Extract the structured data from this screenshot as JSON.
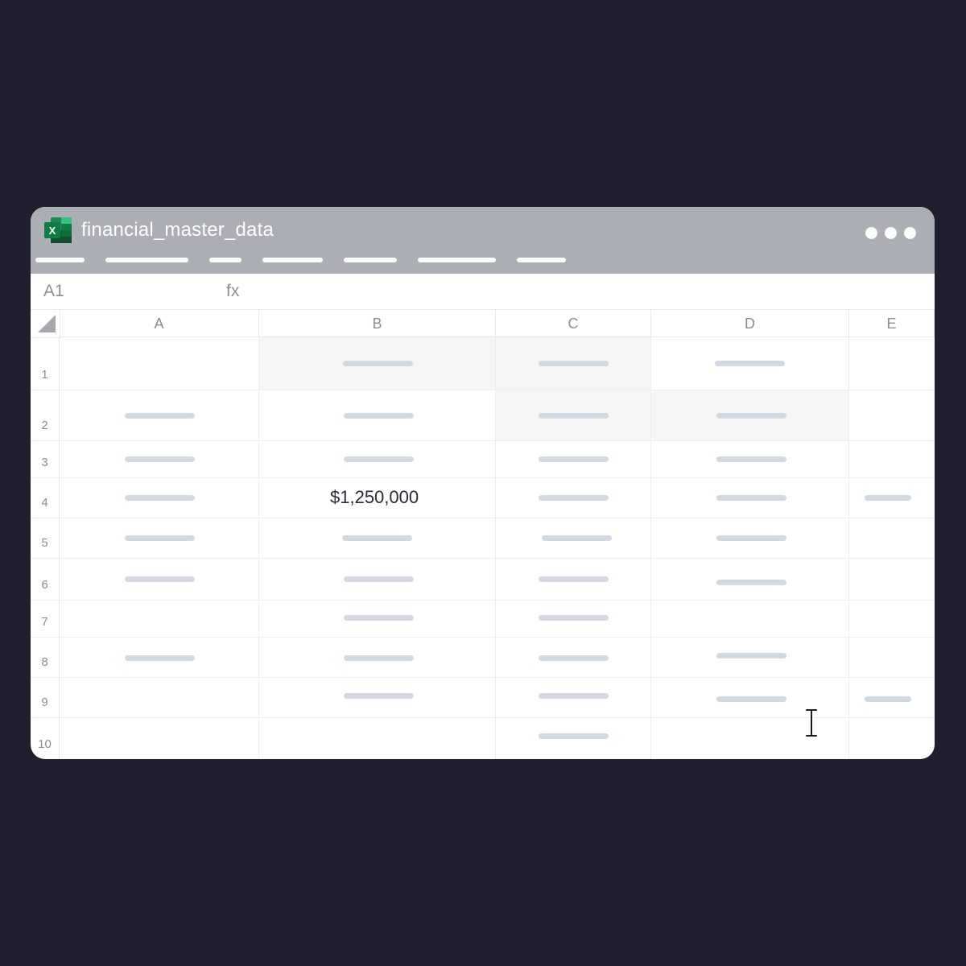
{
  "window": {
    "title": "financial_master_data",
    "app_icon": "excel-icon",
    "window_controls": [
      "dot",
      "dot",
      "dot"
    ],
    "menu_item_count": 7
  },
  "formula_bar": {
    "cell_reference": "A1",
    "fx_label": "fx",
    "formula": ""
  },
  "sheet": {
    "columns": [
      "A",
      "B",
      "C",
      "D",
      "E"
    ],
    "rows": [
      "1",
      "2",
      "3",
      "4",
      "5",
      "6",
      "7",
      "8",
      "9",
      "10"
    ],
    "highlighted_value": {
      "cell": "B4",
      "text": "$1,250,000"
    }
  },
  "colors": {
    "background": "#1f1f30",
    "titlebar": "#abaeb5",
    "placeholder": "#d3d9e2",
    "shaded_cell": "#f4f5f4"
  },
  "cursor": "text-cursor-icon"
}
